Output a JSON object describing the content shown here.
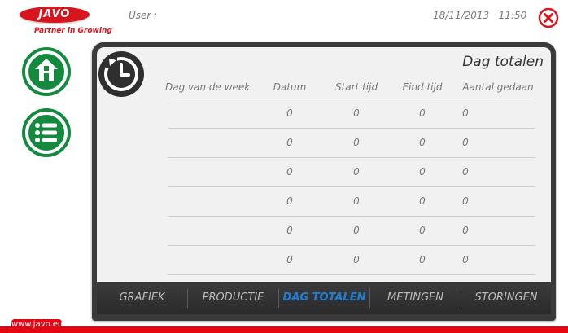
{
  "header": {
    "brand": "JAVO",
    "tagline": "Partner in Growing",
    "user_label": "User :",
    "date": "18/11/2013",
    "time": "11:50"
  },
  "nav": {
    "home_icon": "home-icon",
    "list_icon": "list-icon"
  },
  "panel": {
    "title": "Dag totalen",
    "icon": "reset-clock-icon",
    "columns": [
      "Dag van de week",
      "Datum",
      "Start tijd",
      "Eind tijd",
      "Aantal gedaan"
    ],
    "rows": [
      [
        "",
        "0",
        "0",
        "0",
        "0"
      ],
      [
        "",
        "0",
        "0",
        "0",
        "0"
      ],
      [
        "",
        "0",
        "0",
        "0",
        "0"
      ],
      [
        "",
        "0",
        "0",
        "0",
        "0"
      ],
      [
        "",
        "0",
        "0",
        "0",
        "0"
      ],
      [
        "",
        "0",
        "0",
        "0",
        "0"
      ]
    ]
  },
  "tabs": [
    {
      "label": "GRAFIEK",
      "active": false
    },
    {
      "label": "PRODUCTIE",
      "active": false
    },
    {
      "label": "DAG TOTALEN",
      "active": true
    },
    {
      "label": "METINGEN",
      "active": false
    },
    {
      "label": "STORINGEN",
      "active": false
    }
  ],
  "footer": {
    "url": "www.javo.eu"
  },
  "colors": {
    "brand_red": "#e30613",
    "nav_green": "#138a3e",
    "active_tab": "#1f7fd8",
    "close_red": "#d8141c"
  }
}
